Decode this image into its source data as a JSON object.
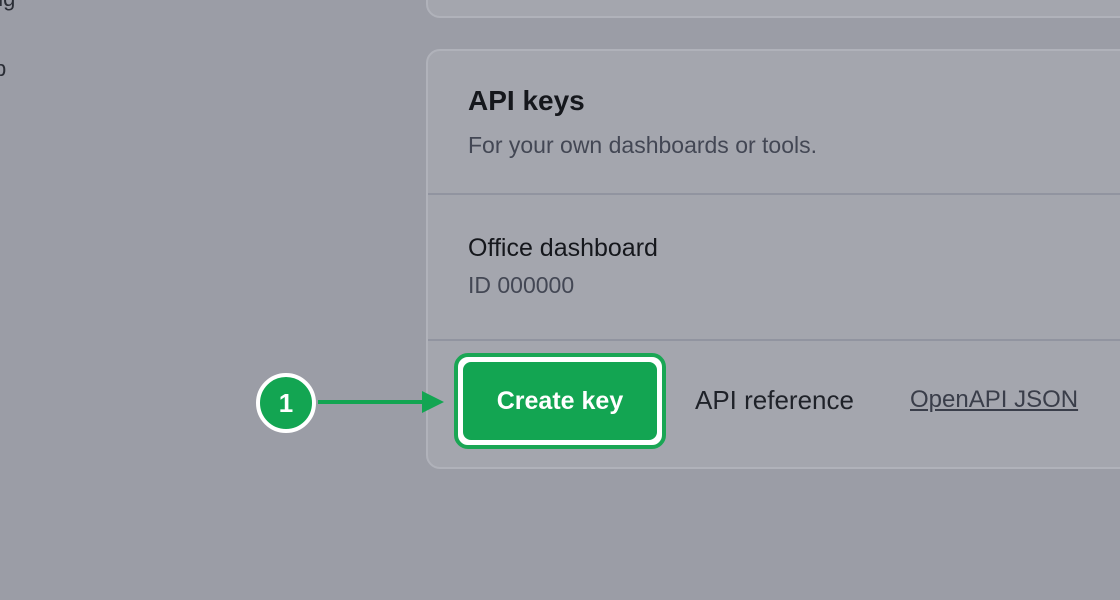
{
  "sidebar": {
    "item_partial_1": "ing",
    "item_partial_2": "p"
  },
  "api_keys_card": {
    "title": "API keys",
    "subtitle": "For your own dashboards or tools.",
    "items": [
      {
        "name": "Office dashboard",
        "id": "ID 000000"
      }
    ],
    "create_button_label": "Create key",
    "api_reference_label": "API reference",
    "openapi_link_label": "OpenAPI JSON"
  },
  "annotation": {
    "step_number": "1",
    "color": "#13a552"
  }
}
